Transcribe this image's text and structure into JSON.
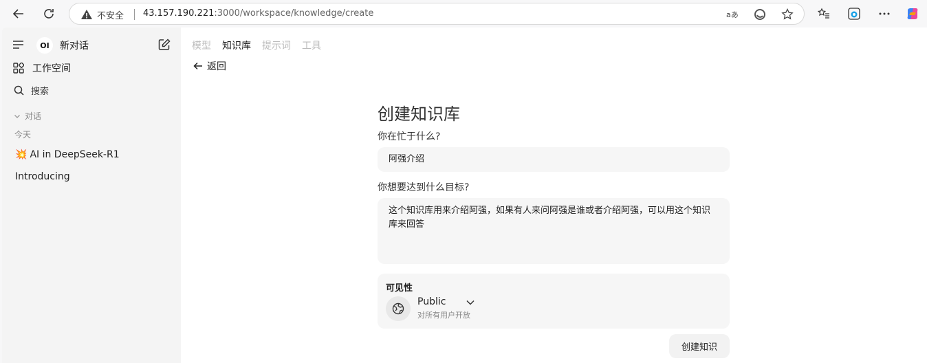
{
  "browser": {
    "insecure_label": "不安全",
    "url_host": "43.157.190.221",
    "url_path": ":3000/workspace/knowledge/create"
  },
  "sidebar": {
    "logo_text": "OI",
    "new_chat_label": "新对话",
    "workspace_label": "工作空间",
    "search_label": "搜索",
    "chats_section_label": "对话",
    "today_label": "今天",
    "chats": [
      {
        "label": "AI in DeepSeek-R1",
        "emoji": "💥"
      },
      {
        "label": "Introducing"
      }
    ]
  },
  "main": {
    "tabs": [
      {
        "label": "模型",
        "active": false
      },
      {
        "label": "知识库",
        "active": true
      },
      {
        "label": "提示词",
        "active": false
      },
      {
        "label": "工具",
        "active": false
      }
    ],
    "back_label": "返回",
    "form": {
      "title": "创建知识库",
      "name_label": "你在忙于什么?",
      "name_value": "阿强介绍",
      "goal_label": "你想要达到什么目标?",
      "goal_value": "这个知识库用来介绍阿强，如果有人来问阿强是谁或者介绍阿强，可以用这个知识库来回答",
      "visibility": {
        "title": "可见性",
        "value": "Public",
        "description": "对所有用户开放"
      },
      "submit_label": "创建知识"
    }
  }
}
